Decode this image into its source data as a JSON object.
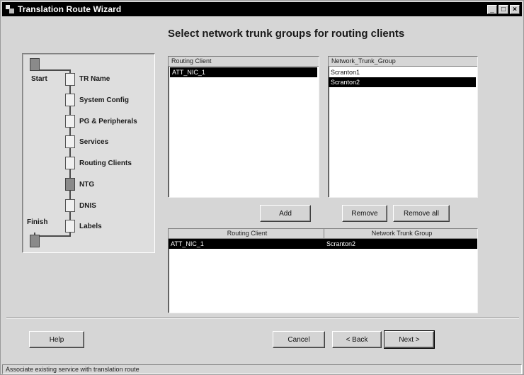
{
  "window": {
    "title": "Translation Route Wizard",
    "minimize_glyph": "_",
    "maximize_glyph": "□",
    "close_glyph": "×"
  },
  "heading": "Select network trunk groups for routing clients",
  "steps": {
    "start_label": "Start",
    "finish_label": "Finish",
    "items": [
      {
        "label": "TR Name",
        "current": false
      },
      {
        "label": "System Config",
        "current": false
      },
      {
        "label": "PG & Peripherals",
        "current": false
      },
      {
        "label": "Services",
        "current": false
      },
      {
        "label": "Routing Clients",
        "current": false
      },
      {
        "label": "NTG",
        "current": true
      },
      {
        "label": "DNIS",
        "current": false
      },
      {
        "label": "Labels",
        "current": false
      }
    ]
  },
  "routing_client_list": {
    "header": "Routing Client",
    "items": [
      {
        "label": "ATT_NIC_1",
        "selected": true
      }
    ]
  },
  "ntg_list": {
    "header": "Network_Trunk_Group",
    "items": [
      {
        "label": "Scranton1",
        "selected": false
      },
      {
        "label": "Scranton2",
        "selected": true
      }
    ]
  },
  "buttons": {
    "add": "Add",
    "remove": "Remove",
    "remove_all": "Remove all",
    "help": "Help",
    "cancel": "Cancel",
    "back": "< Back",
    "next": "Next >"
  },
  "assignments": {
    "headers": [
      "Routing Client",
      "Network Trunk Group"
    ],
    "rows": [
      {
        "routing_client": "ATT_NIC_1",
        "ntg": "Scranton2",
        "selected": true
      }
    ]
  },
  "status_bar": "Associate existing service with translation route"
}
